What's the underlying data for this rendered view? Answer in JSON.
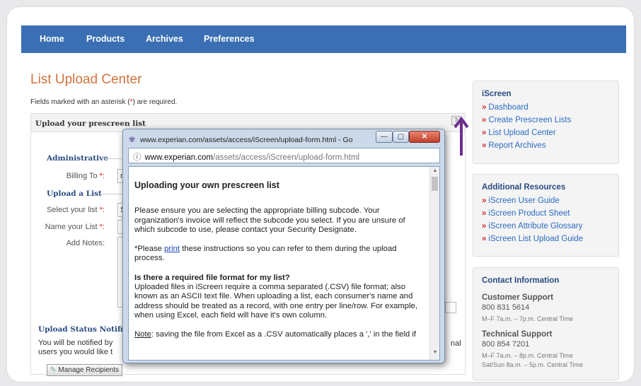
{
  "nav": {
    "items": [
      "Home",
      "Products",
      "Archives",
      "Preferences"
    ]
  },
  "page": {
    "title": "List Upload Center",
    "required_prefix": "Fields marked with an asterisk (",
    "required_ast": "*",
    "required_suffix": ") are required."
  },
  "panel": {
    "header": "Upload your prescreen list",
    "help": "?",
    "admin_title": "Administrative",
    "billing_label": "Billing To",
    "billing_value": "n",
    "upload_title": "Upload a List",
    "select_label": "Select your list",
    "select_value": "S",
    "name_label": "Name your List",
    "notes_label": "Add Notes:",
    "ast": "*:",
    "status_title": "Upload Status Notificat",
    "status_line1": "You will be notified by",
    "status_line2": "users you would like t",
    "status_tail": "nal",
    "manage_button": "Manage Recipients"
  },
  "sidebar": {
    "iscreen": {
      "title": "iScreen",
      "links": [
        "Dashboard",
        "Create Prescreen Lists",
        "List Upload Center",
        "Report Archives"
      ]
    },
    "resources": {
      "title": "Additional Resources",
      "links": [
        "iScreen User Guide",
        "iScreen Product Sheet",
        "iScreen Attribute Glossary",
        "iScreen List Upload Guide"
      ]
    },
    "contact": {
      "title": "Contact Information",
      "customer_name": "Customer Support",
      "customer_phone": "800 831 5614",
      "customer_hours": "M–F 7a.m. – 7p.m. Central Time",
      "tech_name": "Technical Support",
      "tech_phone": "800 854 7201",
      "tech_hours1": "M–F 7a.m. – 8p.m. Central Time",
      "tech_hours2": "Sat/Sun 8a.m. – 5p.m. Central Time"
    },
    "link_marker": "»"
  },
  "popup": {
    "window_title": "www.experian.com/assets/access/iScreen/upload-form.html - Google ...",
    "address_host": "www.experian.com",
    "address_path": "/assets/access/iScreen/upload-form.html",
    "info_glyph": "ⓘ",
    "heading": "Uploading your own prescreen list",
    "para1": "Please ensure you are selecting the appropriate billing subcode. Your organization's invoice will reflect the subcode you select. If you are unsure of which subcode to use, please contact your Security Designate.",
    "para2_pre": "*Please ",
    "para2_link": "print",
    "para2_post": " these instructions so you can refer to them during the upload process.",
    "question": "Is there a required file format for my list?",
    "answer": "Uploaded files in iScreen require a comma separated (.CSV) file format; also known as an ASCII text file. When uploading a list, each consumer's name and address should be treated as a record, with one entry per line/row. For example, when using Excel, each field will have it's own column.",
    "note_label": "Note",
    "note_text": ": saving the file from Excel as a .CSV automatically places a ',' in the field if"
  },
  "colors": {
    "nav": "#3a6fb4",
    "title": "#d0743c",
    "link": "#2a6bc2",
    "arrow": "#6b2d8e"
  }
}
